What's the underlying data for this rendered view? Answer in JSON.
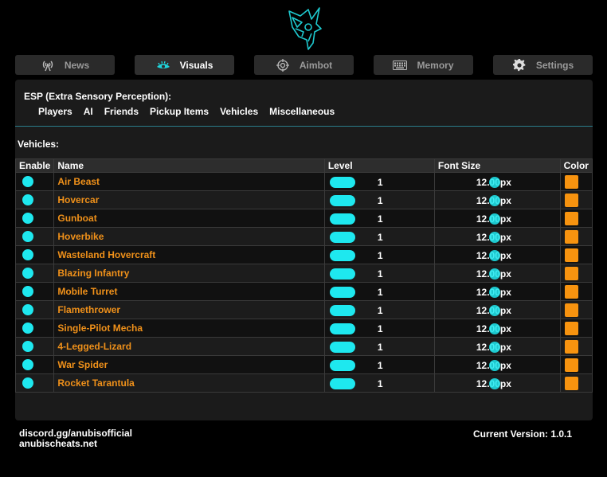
{
  "nav": {
    "tabs": [
      {
        "label": "News",
        "icon": "antenna-icon",
        "active": false
      },
      {
        "label": "Visuals",
        "icon": "eye-icon",
        "active": true
      },
      {
        "label": "Aimbot",
        "icon": "crosshair-icon",
        "active": false
      },
      {
        "label": "Memory",
        "icon": "keyboard-icon",
        "active": false
      },
      {
        "label": "Settings",
        "icon": "gear-icon",
        "active": false
      }
    ]
  },
  "esp": {
    "title": "ESP (Extra Sensory Perception):",
    "subtabs": [
      "Players",
      "AI",
      "Friends",
      "Pickup Items",
      "Vehicles",
      "Miscellaneous"
    ]
  },
  "section": {
    "label": "Vehicles:"
  },
  "table": {
    "headers": {
      "enable": "Enable",
      "name": "Name",
      "level": "Level",
      "font_size": "Font Size",
      "color": "Color"
    },
    "rows": [
      {
        "name": "Air Beast",
        "level": "1",
        "font": "12.00px"
      },
      {
        "name": "Hovercar",
        "level": "1",
        "font": "12.00px"
      },
      {
        "name": "Gunboat",
        "level": "1",
        "font": "12.00px"
      },
      {
        "name": "Hoverbike",
        "level": "1",
        "font": "12.00px"
      },
      {
        "name": "Wasteland Hovercraft",
        "level": "1",
        "font": "12.00px"
      },
      {
        "name": "Blazing Infantry",
        "level": "1",
        "font": "12.00px"
      },
      {
        "name": "Mobile Turret",
        "level": "1",
        "font": "12.00px"
      },
      {
        "name": "Flamethrower",
        "level": "1",
        "font": "12.00px"
      },
      {
        "name": "Single-Pilot Mecha",
        "level": "1",
        "font": "12.00px"
      },
      {
        "name": "4-Legged-Lizard",
        "level": "1",
        "font": "12.00px"
      },
      {
        "name": "War Spider",
        "level": "1",
        "font": "12.00px"
      },
      {
        "name": "Rocket Tarantula",
        "level": "1",
        "font": "12.00px"
      }
    ]
  },
  "footer": {
    "discord": "discord.gg/anubisofficial",
    "site": "anubischeats.net",
    "version": "Current Version: 1.0.1"
  },
  "colors": {
    "accent": "#1ee8ef",
    "name_text": "#f0911a",
    "swatch": "#f7930f",
    "divider": "#2a7d8a"
  }
}
